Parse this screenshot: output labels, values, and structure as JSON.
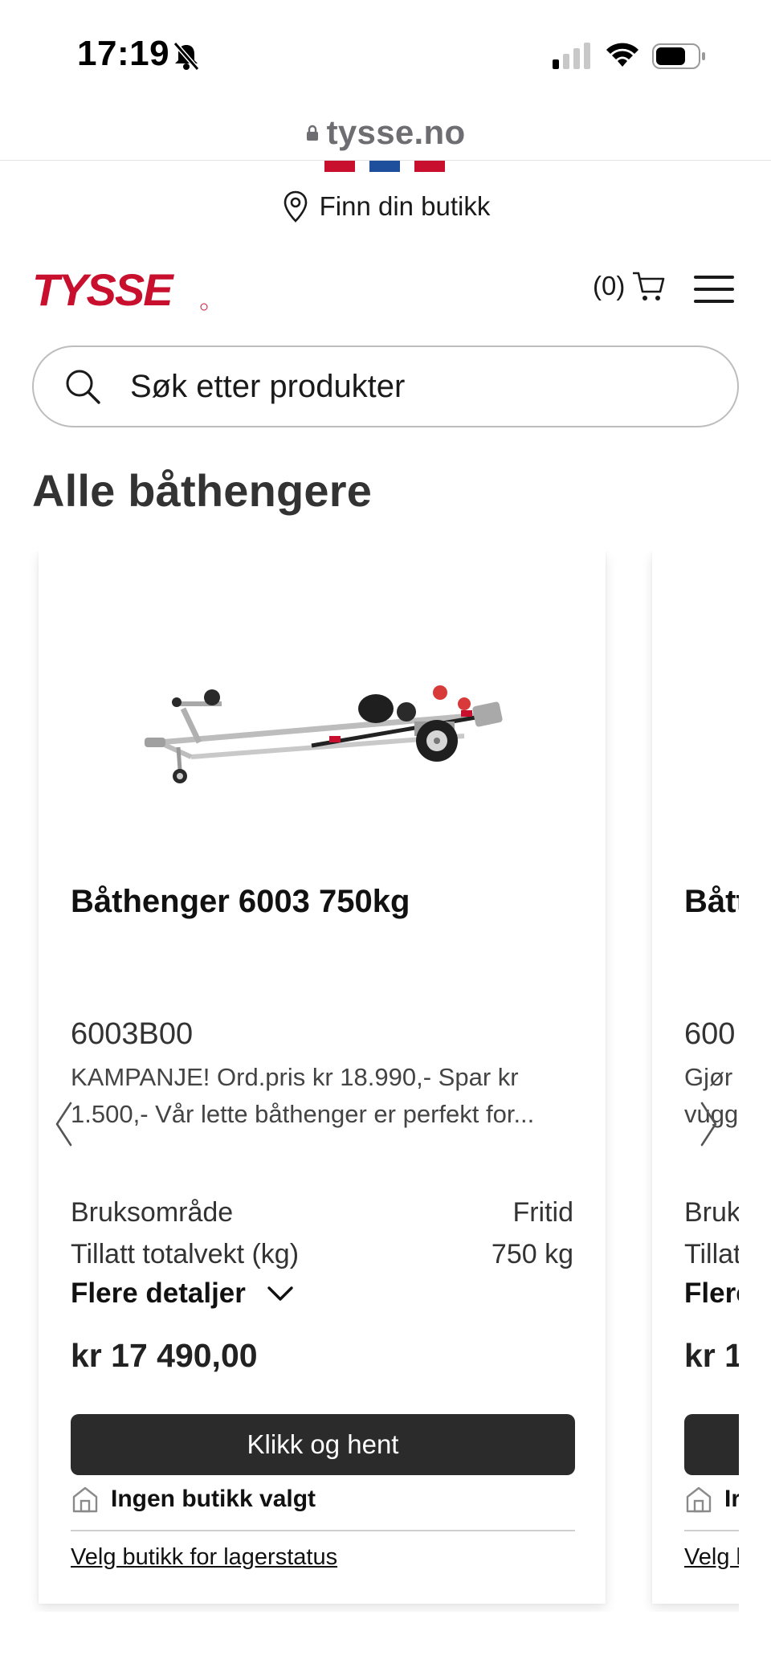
{
  "status_bar": {
    "time": "17:19"
  },
  "browser": {
    "url": "tysse.no"
  },
  "header": {
    "store_finder_label": "Finn din butikk",
    "logo_text": "TYSSE",
    "cart_count": "(0)",
    "brand_color": "#c8102e"
  },
  "search": {
    "placeholder": "Søk etter produkter"
  },
  "page": {
    "title": "Alle båthengere"
  },
  "products": [
    {
      "title": "Båthenger 6003 750kg",
      "sku": "6003B00",
      "description_line1": "KAMPANJE! Ord.pris kr 18.990,- Spar kr",
      "description_line2": "1.500,- Vår lette båthenger er perfekt for...",
      "specs": [
        {
          "label": "Bruksområde",
          "value": "Fritid"
        },
        {
          "label": "Tillatt totalvekt (kg)",
          "value": "750 kg"
        }
      ],
      "details_label": "Flere detaljer",
      "price": "kr 17 490,00",
      "button_label": "Klikk og hent",
      "store_status": "Ingen butikk valgt",
      "store_link": "Velg butikk for lagerstatus"
    },
    {
      "title": "Bått",
      "sku": "600",
      "description_line1": "Gjør",
      "description_line2": "vugg",
      "specs": [
        {
          "label": "Bruk",
          "value": ""
        },
        {
          "label": "Tillat",
          "value": ""
        }
      ],
      "details_label": "Flere",
      "price": "kr 1",
      "button_label": "",
      "store_status": "Ir",
      "store_link": "Velg b"
    }
  ]
}
